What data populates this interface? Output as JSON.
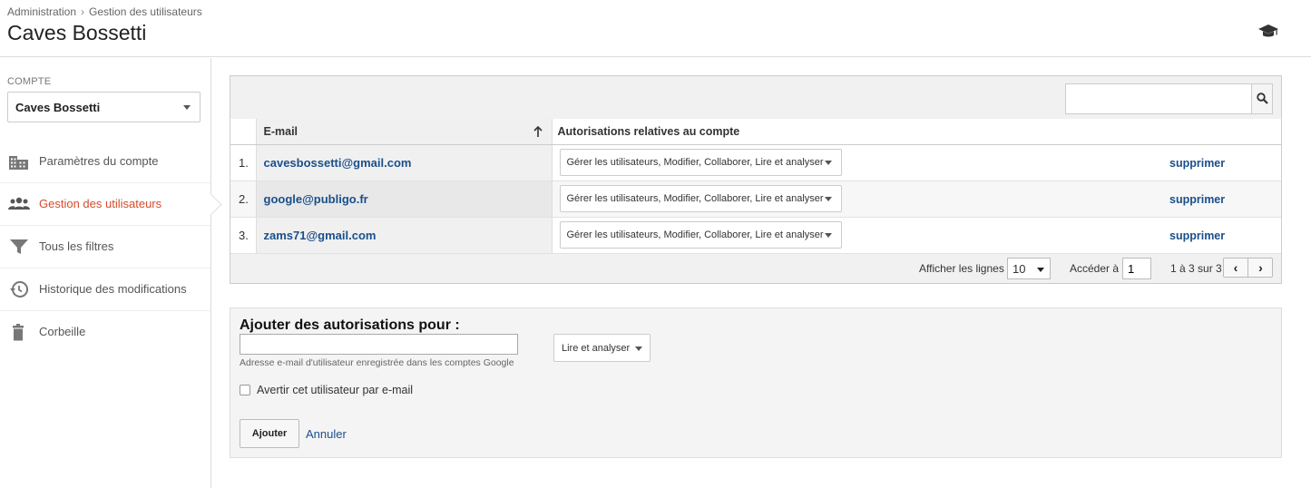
{
  "header": {
    "breadcrumb": [
      "Administration",
      "Gestion des utilisateurs"
    ],
    "breadcrumb_separator": "›",
    "title": "Caves Bossetti",
    "help_icon": "graduation-cap-icon"
  },
  "sidebar": {
    "account_label": "COMPTE",
    "account_selected": "Caves Bossetti",
    "items": [
      {
        "label": "Paramètres du compte",
        "icon": "building-icon",
        "active": false
      },
      {
        "label": "Gestion des utilisateurs",
        "icon": "users-icon",
        "active": true
      },
      {
        "label": "Tous les filtres",
        "icon": "filter-icon",
        "active": false
      },
      {
        "label": "Historique des modifications",
        "icon": "history-icon",
        "active": false
      },
      {
        "label": "Corbeille",
        "icon": "trash-icon",
        "active": false
      }
    ]
  },
  "users_table": {
    "search_placeholder": "",
    "columns": {
      "email": "E-mail",
      "permissions": "Autorisations relatives au compte"
    },
    "rows": [
      {
        "index": "1.",
        "email": "cavesbossetti@gmail.com",
        "permissions": "Gérer les utilisateurs, Modifier, Collaborer, Lire et analyser",
        "action": "supprimer"
      },
      {
        "index": "2.",
        "email": "google@publigo.fr",
        "permissions": "Gérer les utilisateurs, Modifier, Collaborer, Lire et analyser",
        "action": "supprimer"
      },
      {
        "index": "3.",
        "email": "zams71@gmail.com",
        "permissions": "Gérer les utilisateurs, Modifier, Collaborer, Lire et analyser",
        "action": "supprimer"
      }
    ],
    "pager": {
      "rows_label": "Afficher les lignes :",
      "rows_value": "10",
      "goto_label": "Accéder à :",
      "goto_value": "1",
      "range": "1 à 3 sur 3",
      "prev": "‹",
      "next": "›"
    }
  },
  "add_panel": {
    "title": "Ajouter des autorisations pour :",
    "email_value": "",
    "hint": "Adresse e-mail d'utilisateur enregistrée dans les comptes Google",
    "role_value": "Lire et analyser",
    "notify_label": "Avertir cet utilisateur par e-mail",
    "notify_checked": false,
    "add_label": "Ajouter",
    "cancel_label": "Annuler"
  },
  "colors": {
    "active_nav": "#d64b2d",
    "link": "#1a4f8b"
  }
}
